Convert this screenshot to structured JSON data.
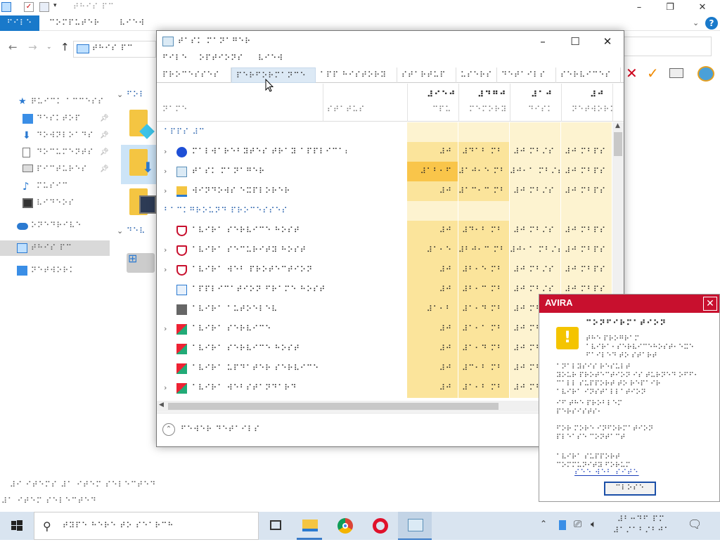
{
  "explorer": {
    "title": "⠞⠓⠊⠎ ⠏⠉",
    "ribbon_tabs": [
      "⠋⠊⠇⠑",
      "⠉⠕⠍⠏⠥⠞⠑⠗",
      "⠧⠊⠑⠺"
    ],
    "address": "⠞⠓⠊⠎ ⠏⠉",
    "sidebar": [
      {
        "label": "⠟⠥⠊⠉⠅ ⠁⠉⠉⠑⠎⠎",
        "icon": "star-icon",
        "pinned": false
      },
      {
        "label": "⠙⠑⠎⠅⠞⠕⠏",
        "icon": "desktop-icon",
        "pinned": true
      },
      {
        "label": "⠙⠕⠺⠝⠇⠕⠁⠙⠎",
        "icon": "download-icon",
        "pinned": true
      },
      {
        "label": "⠙⠕⠉⠥⠍⠑⠝⠞⠎",
        "icon": "document-icon",
        "pinned": true
      },
      {
        "label": "⠏⠊⠉⠞⠥⠗⠑⠎",
        "icon": "pictures-icon",
        "pinned": true
      },
      {
        "label": "⠍⠥⠎⠊⠉",
        "icon": "music-icon",
        "pinned": false
      },
      {
        "label": "⠧⠊⠙⠑⠕⠎",
        "icon": "video-icon",
        "pinned": false
      },
      {
        "label": "⠕⠝⠑⠙⠗⠊⠧⠑",
        "icon": "cloud-icon",
        "pinned": false
      },
      {
        "label": "⠞⠓⠊⠎ ⠏⠉",
        "icon": "pc-icon",
        "pinned": false,
        "selected": true
      },
      {
        "label": "⠝⠑⠞⠺⠕⠗⠅",
        "icon": "network-icon",
        "pinned": false
      }
    ],
    "section_headers": [
      "⠋⠕⠇",
      "⠙⠑⠧"
    ],
    "status_items": "⠼⠊ ⠊⠞⠑⠍⠎   ⠼⠁ ⠊⠞⠑⠍ ⠎⠑⠇⠑⠉⠞⠑⠙",
    "status_selected": "⠼⠁ ⠊⠞⠑⠍ ⠎⠑⠇⠑⠉⠞⠑⠙"
  },
  "task_manager": {
    "title": "⠞⠁⠎⠅ ⠍⠁⠝⠁⠛⠑⠗",
    "menu": [
      "⠋⠊⠇⠑",
      "⠕⠏⠞⠊⠕⠝⠎",
      "⠧⠊⠑⠺"
    ],
    "tabs": [
      "⠏⠗⠕⠉⠑⠎⠎⠑⠎",
      "⠏⠑⠗⠋⠕⠗⠍⠁⠝⠉⠑",
      "⠁⠏⠏ ⠓⠊⠎⠞⠕⠗⠽",
      "⠎⠞⠁⠗⠞⠥⠏",
      "⠥⠎⠑⠗⠎",
      "⠙⠑⠞⠁⠊⠇⠎",
      "⠎⠑⠗⠧⠊⠉⠑⠎"
    ],
    "active_tab": 1,
    "columns": [
      {
        "label": "⠝⠁⠍⠑",
        "value": ""
      },
      {
        "label": "⠎⠞⠁⠞⠥⠎",
        "value": ""
      },
      {
        "label": "⠉⠏⠥",
        "value": "⠼⠊⠑⠚"
      },
      {
        "label": "⠍⠑⠍⠕⠗⠽",
        "value": "⠼⠙⠛⠚"
      },
      {
        "label": "⠙⠊⠎⠅",
        "value": "⠼⠁⠚"
      },
      {
        "label": "⠝⠑⠞⠺⠕⠗⠅",
        "value": "⠼⠚"
      }
    ],
    "rows": [
      {
        "type": "group",
        "name": "⠁⠏⠏⠎ ⠼⠉"
      },
      {
        "type": "proc",
        "expand": true,
        "icon": "malwarebytes-icon",
        "name": "⠍⠁⠇⠺⠁⠗⠑⠃⠽⠞⠑⠎ ⠞⠗⠁⠽ ⠁⠏⠏⠇⠊⠉⠁⠞⠊⠕⠝",
        "cpu": "⠼⠚",
        "mem": "⠼⠙⠁⠃ ⠍⠃",
        "disk": "⠼⠚ ⠍⠃⠌⠎",
        "net": "⠼⠚ ⠍⠃⠏⠎",
        "cpu_level": 0.2
      },
      {
        "type": "proc",
        "expand": true,
        "icon": "taskmgr-icon",
        "name": "⠞⠁⠎⠅ ⠍⠁⠝⠁⠛⠑⠗",
        "cpu": "⠼⠁⠃⠂⠋",
        "mem": "⠼⠁⠚⠂⠑ ⠍⠃",
        "disk": "⠼⠚⠂⠁ ⠍⠃⠌⠎",
        "net": "⠼⠚ ⠍⠃⠏⠎",
        "cpu_level": 0.9
      },
      {
        "type": "proc",
        "expand": true,
        "icon": "explorer-icon",
        "name": "⠺⠊⠝⠙⠕⠺⠎ ⠑⠭⠏⠇⠕⠗⠑⠗",
        "cpu": "⠼⠚",
        "mem": "⠼⠁⠉⠂⠉ ⠍⠃",
        "disk": "⠼⠚ ⠍⠃⠌⠎",
        "net": "⠼⠚ ⠍⠃⠏⠎",
        "cpu_level": 0.2
      },
      {
        "type": "group",
        "name": "⠃⠁⠉⠅⠛⠗⠕⠥⠝⠙ ⠏⠗⠕⠉⠑⠎⠎⠑⠎"
      },
      {
        "type": "proc",
        "expand": false,
        "icon": "avira-shield-icon",
        "name": "⠁⠧⠊⠗⠁ ⠎⠑⠗⠧⠊⠉⠑ ⠓⠕⠎⠞",
        "cpu": "⠼⠚",
        "mem": "⠼⠙⠂⠃ ⠍⠃",
        "disk": "⠼⠚ ⠍⠃⠌⠎",
        "net": "⠼⠚ ⠍⠃⠏⠎",
        "cpu_level": 0.2
      },
      {
        "type": "proc",
        "expand": true,
        "icon": "avira-shield-icon",
        "name": "⠁⠧⠊⠗⠁ ⠎⠑⠉⠥⠗⠊⠞⠽ ⠓⠕⠎⠞",
        "cpu": "⠼⠁⠂⠑",
        "mem": "⠼⠃⠚⠂⠉ ⠍⠃",
        "disk": "⠼⠚⠂⠁ ⠍⠃⠌⠎",
        "net": "⠼⠚ ⠍⠃⠏⠎",
        "cpu_level": 0.4
      },
      {
        "type": "proc",
        "expand": true,
        "icon": "avira-shield-icon",
        "name": "⠁⠧⠊⠗⠁ ⠺⠑⠃ ⠏⠗⠕⠞⠑⠉⠞⠊⠕⠝",
        "cpu": "⠼⠚",
        "mem": "⠼⠃⠂⠑ ⠍⠃",
        "disk": "⠼⠚ ⠍⠃⠌⠎",
        "net": "⠼⠚ ⠍⠃⠏⠎",
        "cpu_level": 0.2
      },
      {
        "type": "proc",
        "expand": false,
        "icon": "app-frame-icon",
        "name": "⠁⠏⠏⠇⠊⠉⠁⠞⠊⠕⠝ ⠋⠗⠁⠍⠑ ⠓⠕⠎⠞",
        "cpu": "⠼⠚",
        "mem": "⠼⠃⠂⠉ ⠍⠃",
        "disk": "⠼⠚ ⠍⠃⠌⠎",
        "net": "⠼⠚ ⠍⠃⠏⠎",
        "cpu_level": 0.2
      },
      {
        "type": "proc",
        "expand": false,
        "icon": "generic-app-icon",
        "name": "⠁⠧⠊⠗⠁ ⠁⠥⠞⠕⠑⠇⠑⠧",
        "cpu": "⠼⠁⠂⠃",
        "mem": "⠼⠁⠂⠙ ⠍⠃",
        "disk": "⠼⠚ ⠍⠃⠌⠎",
        "net": "⠼⠚ ⠍⠃⠏⠎",
        "cpu_level": 0.4
      },
      {
        "type": "proc",
        "expand": true,
        "icon": "colorful-app-icon",
        "name": "⠁⠧⠊⠗⠁ ⠎⠑⠗⠧⠊⠉⠑",
        "cpu": "⠼⠚",
        "mem": "⠼⠁⠂⠁ ⠍⠃",
        "disk": "⠼⠚ ⠍⠃⠌⠎",
        "net": "⠼⠚ ⠍⠃⠏⠎",
        "cpu_level": 0.2
      },
      {
        "type": "proc",
        "expand": false,
        "icon": "colorful-app-icon",
        "name": "⠁⠧⠊⠗⠁ ⠎⠑⠗⠧⠊⠉⠑ ⠓⠕⠎⠞",
        "cpu": "⠼⠚",
        "mem": "⠼⠁⠂⠙ ⠍⠃",
        "disk": "⠼⠚ ⠍⠃⠌⠎",
        "net": "⠼⠚ ⠍⠃⠏⠎",
        "cpu_level": 0.2
      },
      {
        "type": "proc",
        "expand": false,
        "icon": "colorful-app-icon",
        "name": "⠁⠧⠊⠗⠁ ⠥⠏⠙⠁⠞⠑⠗ ⠎⠑⠗⠧⠊⠉⠑",
        "cpu": "⠼⠚",
        "mem": "⠼⠉⠂⠃ ⠍⠃",
        "disk": "⠼⠚ ⠍⠃⠌⠎",
        "net": "⠼⠚ ⠍⠃⠏⠎",
        "cpu_level": 0.2
      },
      {
        "type": "proc",
        "expand": true,
        "icon": "colorful-app-icon",
        "name": "⠁⠧⠊⠗⠁ ⠺⠑⠃⠎⠞⠁⠝⠙⠁⠗⠙",
        "cpu": "⠼⠚",
        "mem": "⠼⠁⠂⠃ ⠍⠃",
        "disk": "⠼⠚ ⠍⠃⠌⠎",
        "net": "⠼⠚ ⠍⠃⠏⠎",
        "cpu_level": 0.2
      }
    ],
    "fewer_details": "⠋⠑⠺⠑⠗ ⠙⠑⠞⠁⠊⠇⠎"
  },
  "avira": {
    "logo": "AVIRA",
    "title": "⠉⠕⠝⠋⠊⠗⠍⠁⠞⠊⠕⠝",
    "line1": "⠞⠓⠑ ⠏⠗⠕⠛⠗⠁⠍",
    "line2": "⠁⠧⠊⠗⠁⠂⠎⠑⠗⠧⠊⠉⠑⠓⠕⠎⠞⠂⠑⠭⠑",
    "line3": "⠋⠁⠊⠇⠑⠙ ⠞⠕ ⠎⠞⠁⠗⠞",
    "para1_a": "⠁⠝⠁⠇⠽⠎⠊⠎ ⠗⠑⠎⠥⠇⠞",
    "para1_b": "⠽⠕⠥⠗ ⠏⠗⠕⠞⠑⠉⠞⠊⠕⠝ ⠊⠎ ⠞⠥⠗⠝⠑⠙ ⠕⠋⠋⠂",
    "para1_c": "⠉⠁⠇⠇ ⠎⠥⠏⠏⠕⠗⠞ ⠞⠕ ⠗⠑⠏⠁⠊⠗",
    "para1_d": "⠁⠧⠊⠗⠁ ⠊⠝⠎⠞⠁⠇⠇⠁⠞⠊⠕⠝",
    "para1_e": "⠊⠋ ⠞⠓⠑ ⠏⠗⠕⠃⠇⠑⠍",
    "para1_f": "⠏⠑⠗⠎⠊⠎⠞⠎⠂",
    "para2_a": "⠋⠕⠗ ⠍⠕⠗⠑ ⠊⠝⠋⠕⠗⠍⠁⠞⠊⠕⠝",
    "para2_b": "⠏⠇⠑⠁⠎⠑ ⠉⠕⠝⠞⠁⠉⠞",
    "para3_a": "⠁⠧⠊⠗⠁ ⠎⠥⠏⠏⠕⠗⠞",
    "para3_b": "⠉⠕⠍⠍⠥⠝⠊⠞⠽ ⠋⠕⠗⠥⠍",
    "link": "⠎⠑⠑ ⠺⠑⠃ ⠎⠊⠞⠑",
    "button": "⠉⠇⠕⠎⠑"
  },
  "taskbar": {
    "search_placeholder": "⠞⠽⠏⠑ ⠓⠑⠗⠑ ⠞⠕ ⠎⠑⠁⠗⠉⠓",
    "clock_time": "⠼⠃⠒⠙⠋ ⠏⠍",
    "clock_date": "⠼⠁⠌⠁⠃⠌⠃⠚⠁⠛"
  },
  "colors": {
    "accent": "#1979ca",
    "avira_red": "#c8102e",
    "cpu_hot": "#f9c54a",
    "cpu_warm": "#fbe49b",
    "cell_light": "#fdf3d0"
  }
}
